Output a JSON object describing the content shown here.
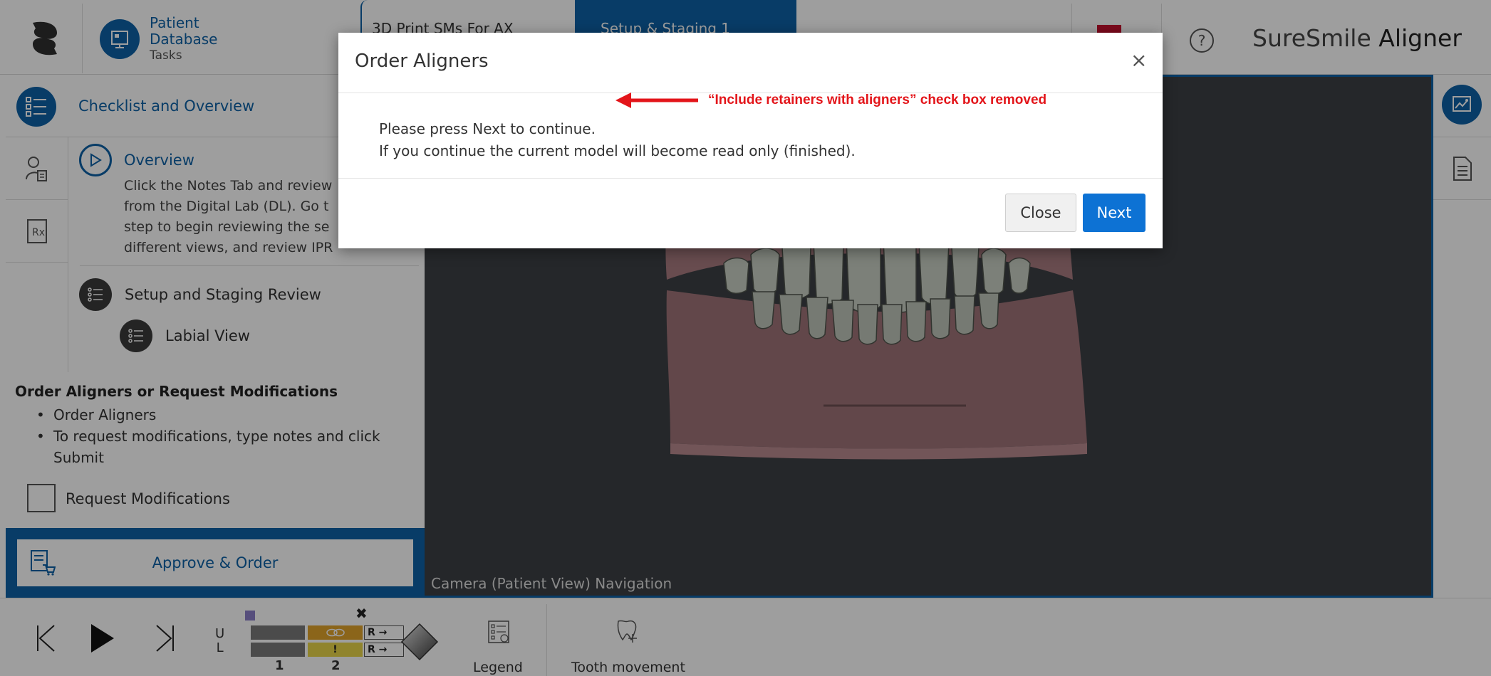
{
  "header": {
    "nav_line1": "Patient",
    "nav_line2": "Database",
    "nav_line3": "Tasks",
    "tabs": [
      {
        "label": "3D Print SMs For AX"
      },
      {
        "label": "Setup & Staging 1"
      }
    ],
    "brand_part1": "SureSmile",
    "brand_part2": "Aligner",
    "help_glyph": "?"
  },
  "left_panel": {
    "checklist_title": "Checklist and Overview",
    "overview_title": "Overview",
    "overview_lines": [
      "Click the Notes Tab and review",
      "from the Digital Lab (DL). Go t",
      "step to begin reviewing the se",
      "different views, and review IPR"
    ],
    "step_setup": "Setup and Staging Review",
    "step_labial": "Labial View",
    "order_title": "Order Aligners or Request Modifications",
    "order_items": [
      "Order Aligners",
      "To request modifications, type notes and click Submit"
    ],
    "request_label": "Request Modifications",
    "approve_label": "Approve & Order"
  },
  "viewport": {
    "camera_label": "Camera (Patient View) Navigation"
  },
  "bottom": {
    "upper_label": "U",
    "lower_label": "L",
    "stage_1": "1",
    "stage_2": "2",
    "stage_marker": "✖",
    "r_upper": "R →",
    "r_lower": "R →",
    "warning": "!",
    "legend_label": "Legend",
    "tooth_label": "Tooth movement"
  },
  "modal": {
    "title": "Order Aligners",
    "close_x": "×",
    "annotation": "“Include retainers with aligners” check box removed",
    "body_line1": "Please press Next to continue.",
    "body_line2": "If you continue the current model will become read only (finished).",
    "close_button": "Close",
    "next_button": "Next"
  },
  "colors": {
    "accent": "#0d62a6",
    "next_button": "#0d72d4",
    "annotation_red": "#e3151a",
    "viewport_bg": "#3c3f44",
    "gum": "#a87b80",
    "teeth": "#c9cfc4",
    "stage_orange": "#e0a32a",
    "stage_yellow": "#e8d64a"
  }
}
